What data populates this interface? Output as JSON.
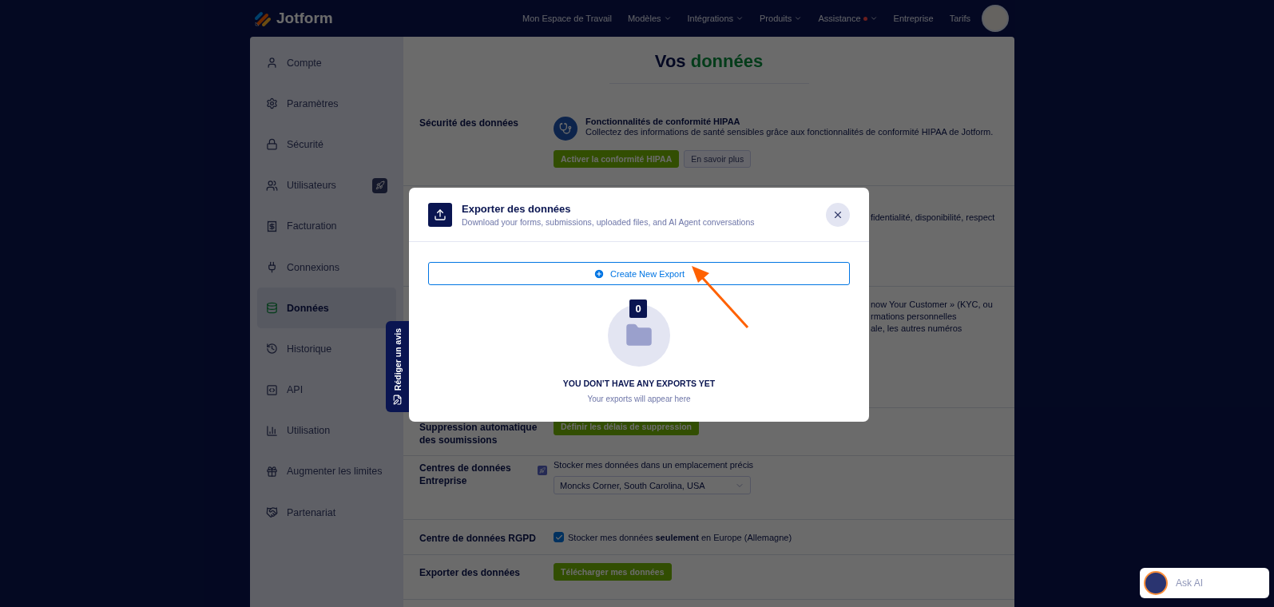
{
  "nav": {
    "logo": "Jotform",
    "items": [
      {
        "label": "Mon Espace de Travail",
        "dropdown": false,
        "dot": false
      },
      {
        "label": "Modèles",
        "dropdown": true,
        "dot": false
      },
      {
        "label": "Intégrations",
        "dropdown": true,
        "dot": false
      },
      {
        "label": "Produits",
        "dropdown": true,
        "dot": false
      },
      {
        "label": "Assistance",
        "dropdown": true,
        "dot": true
      },
      {
        "label": "Entreprise",
        "dropdown": false,
        "dot": false
      },
      {
        "label": "Tarifs",
        "dropdown": false,
        "dot": false
      }
    ]
  },
  "sidebar": {
    "items": [
      {
        "label": "Compte",
        "selected": false,
        "upgrade": false
      },
      {
        "label": "Paramètres",
        "selected": false,
        "upgrade": false
      },
      {
        "label": "Sécurité",
        "selected": false,
        "upgrade": false
      },
      {
        "label": "Utilisateurs",
        "selected": false,
        "upgrade": true
      },
      {
        "label": "Facturation",
        "selected": false,
        "upgrade": false
      },
      {
        "label": "Connexions",
        "selected": false,
        "upgrade": false
      },
      {
        "label": "Données",
        "selected": true,
        "upgrade": false
      },
      {
        "label": "Historique",
        "selected": false,
        "upgrade": false
      },
      {
        "label": "API",
        "selected": false,
        "upgrade": false
      },
      {
        "label": "Utilisation",
        "selected": false,
        "upgrade": false
      },
      {
        "label": "Augmenter les limites",
        "selected": false,
        "upgrade": false
      },
      {
        "label": "Partenariat",
        "selected": false,
        "upgrade": false
      }
    ]
  },
  "page": {
    "title": "Vos",
    "title_accent": "données",
    "sections": [
      {
        "kind": "feature",
        "label": "Sécurité des données",
        "heading": "Fonctionnalités de conformité HIPAA",
        "text": "Collectez des informations de santé sensibles grâce aux fonctionnalités de conformité HIPAA de Jotform.",
        "buttons": [
          {
            "label": "Activer la conformité HIPAA",
            "kind": "primary"
          },
          {
            "label": "En savoir plus",
            "kind": "secondary"
          }
        ]
      },
      {
        "kind": "fragment",
        "lines": [
          "fidentialité, disponibilité, respect"
        ]
      },
      {
        "kind": "fragment",
        "lines": [
          "now Your Customer » (KYC, ou",
          "rmations personnelles",
          "ale, les autres numéros"
        ]
      },
      {
        "kind": "button",
        "label": "Suppression automatique des soumissions",
        "buttons": [
          {
            "label": "Définir les délais de suppression",
            "kind": "primary"
          }
        ]
      },
      {
        "kind": "select",
        "label": "Centres de données Entreprise",
        "upgrade": true,
        "caption": "Stocker mes données dans un emplacement précis",
        "value": "Moncks Corner, South Carolina, USA"
      },
      {
        "kind": "checkbox",
        "label": "Centre de données RGPD",
        "text": "Stocker mes données **seulement** en Europe (Allemagne)",
        "checked": true
      },
      {
        "kind": "button",
        "label": "Exporter des données",
        "buttons": [
          {
            "label": "Télécharger mes données",
            "kind": "primary"
          }
        ]
      }
    ]
  },
  "modal": {
    "title": "Exporter des données",
    "subtitle": "Download your forms, submissions, uploaded files, and AI Agent conversations",
    "create_button": "Create New Export",
    "count": "0",
    "empty_title": "YOU DON’T HAVE ANY EXPORTS YET",
    "empty_text": "Your exports will appear here"
  },
  "feedback_tab": "Rédiger un avis",
  "ask_ai": "Ask AI"
}
